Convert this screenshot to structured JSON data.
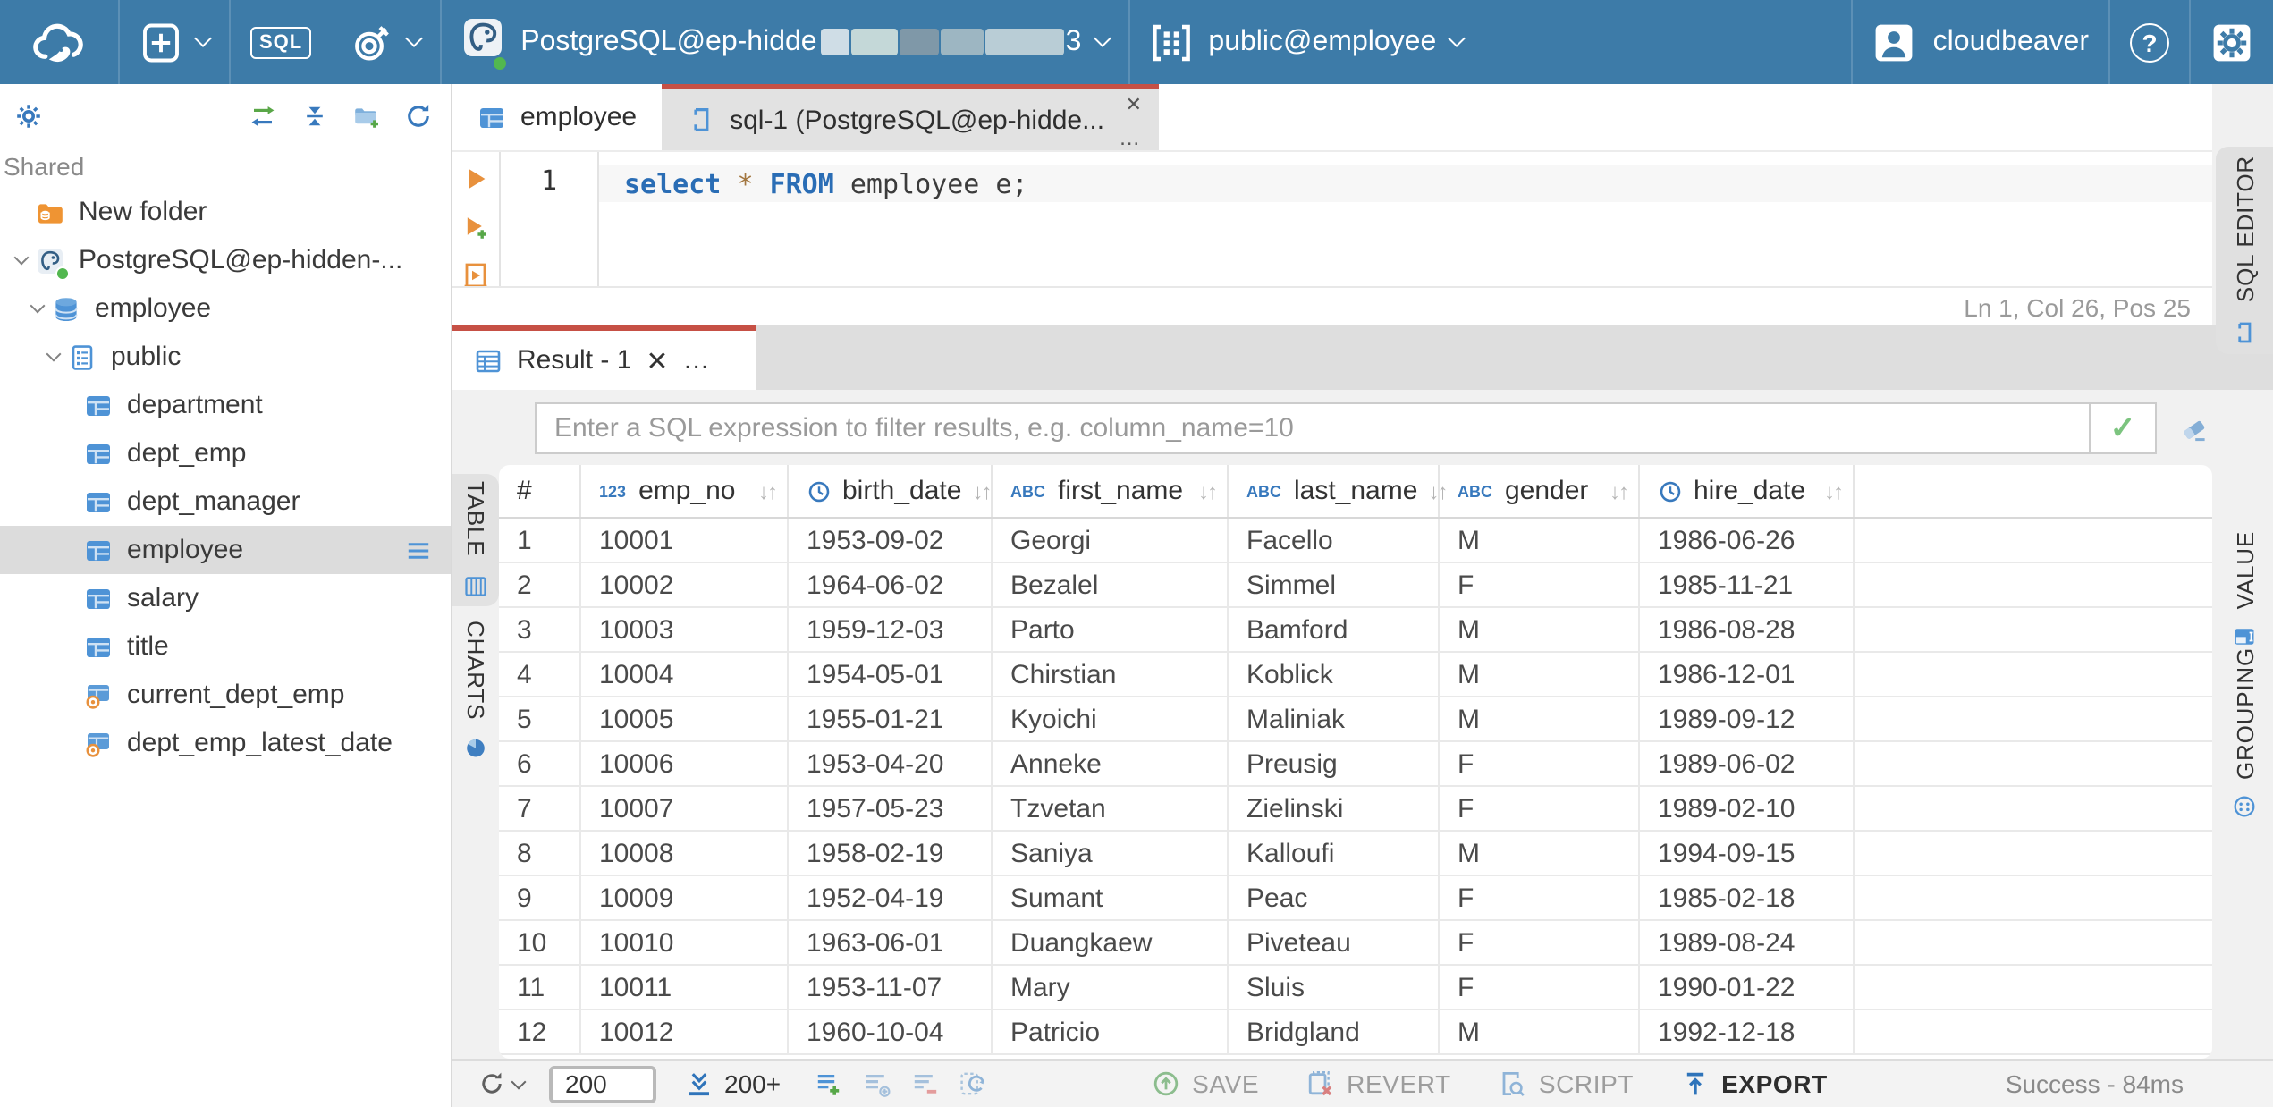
{
  "colors": {
    "topbar_blue": "#3d7ba8",
    "accent_red": "#c65045",
    "icon_blue": "#3879bd",
    "success_green": "#52b74f",
    "orange": "#e8913d"
  },
  "glyphs": {
    "close": "✕",
    "more": "…",
    "check": "✓",
    "sort": "↓↑",
    "help": "?"
  },
  "topbar": {
    "sql_button": "SQL",
    "connection": {
      "name": "PostgreSQL@ep-hidde",
      "suffix": "3"
    },
    "schema": "public@employee",
    "user": "cloudbeaver"
  },
  "sidebar": {
    "section": "Shared",
    "tree": [
      {
        "label": "New folder",
        "icon": "folderdb",
        "depth": 0,
        "expandable": false
      },
      {
        "label": "PostgreSQL@ep-hidden-...",
        "icon": "postgres",
        "depth": 0,
        "expandable": true,
        "status": true
      },
      {
        "label": "employee",
        "icon": "database",
        "depth": 1,
        "expandable": true
      },
      {
        "label": "public",
        "icon": "schema",
        "depth": 2,
        "expandable": true
      },
      {
        "label": "department",
        "icon": "table",
        "depth": 3,
        "expandable": false
      },
      {
        "label": "dept_emp",
        "icon": "table",
        "depth": 3,
        "expandable": false
      },
      {
        "label": "dept_manager",
        "icon": "table",
        "depth": 3,
        "expandable": false
      },
      {
        "label": "employee",
        "icon": "table",
        "depth": 3,
        "expandable": false,
        "selected": true,
        "menu": true
      },
      {
        "label": "salary",
        "icon": "table",
        "depth": 3,
        "expandable": false
      },
      {
        "label": "title",
        "icon": "table",
        "depth": 3,
        "expandable": false
      },
      {
        "label": "current_dept_emp",
        "icon": "view",
        "depth": 3,
        "expandable": false
      },
      {
        "label": "dept_emp_latest_date",
        "icon": "view",
        "depth": 3,
        "expandable": false
      }
    ]
  },
  "editor": {
    "tabs": [
      {
        "label": "employee"
      },
      {
        "label": "sql-1 (PostgreSQL@ep-hidde..."
      }
    ],
    "line_number": "1",
    "code_tokens": [
      {
        "type": "kw",
        "text": "select"
      },
      {
        "type": "plain",
        "text": " "
      },
      {
        "type": "star",
        "text": "*"
      },
      {
        "type": "plain",
        "text": " "
      },
      {
        "type": "kw",
        "text": "FROM"
      },
      {
        "type": "plain",
        "text": " employee e;"
      }
    ],
    "status": "Ln 1, Col 26, Pos 25",
    "side_tab": "SQL EDITOR"
  },
  "result": {
    "tab": "Result - 1",
    "filter_placeholder": "Enter a SQL expression to filter results, e.g. column_name=10",
    "left_tabs": [
      "TABLE",
      "CHARTS"
    ],
    "right_tabs": [
      "VALUE",
      "GROUPING"
    ],
    "table": {
      "columns": [
        {
          "label": "#",
          "type": null,
          "sortable": false
        },
        {
          "label": "emp_no",
          "type": "123",
          "sortable": true
        },
        {
          "label": "birth_date",
          "type": "clock",
          "sortable": true
        },
        {
          "label": "first_name",
          "type": "abc",
          "sortable": true
        },
        {
          "label": "last_name",
          "type": "abc",
          "sortable": true
        },
        {
          "label": "gender",
          "type": "abc",
          "sortable": true
        },
        {
          "label": "hire_date",
          "type": "clock",
          "sortable": true
        }
      ],
      "rows": [
        [
          "1",
          "10001",
          "1953-09-02",
          "Georgi",
          "Facello",
          "M",
          "1986-06-26"
        ],
        [
          "2",
          "10002",
          "1964-06-02",
          "Bezalel",
          "Simmel",
          "F",
          "1985-11-21"
        ],
        [
          "3",
          "10003",
          "1959-12-03",
          "Parto",
          "Bamford",
          "M",
          "1986-08-28"
        ],
        [
          "4",
          "10004",
          "1954-05-01",
          "Chirstian",
          "Koblick",
          "M",
          "1986-12-01"
        ],
        [
          "5",
          "10005",
          "1955-01-21",
          "Kyoichi",
          "Maliniak",
          "M",
          "1989-09-12"
        ],
        [
          "6",
          "10006",
          "1953-04-20",
          "Anneke",
          "Preusig",
          "F",
          "1989-06-02"
        ],
        [
          "7",
          "10007",
          "1957-05-23",
          "Tzvetan",
          "Zielinski",
          "F",
          "1989-02-10"
        ],
        [
          "8",
          "10008",
          "1958-02-19",
          "Saniya",
          "Kalloufi",
          "M",
          "1994-09-15"
        ],
        [
          "9",
          "10009",
          "1952-04-19",
          "Sumant",
          "Peac",
          "F",
          "1985-02-18"
        ],
        [
          "10",
          "10010",
          "1963-06-01",
          "Duangkaew",
          "Piveteau",
          "F",
          "1989-08-24"
        ],
        [
          "11",
          "10011",
          "1953-11-07",
          "Mary",
          "Sluis",
          "F",
          "1990-01-22"
        ],
        [
          "12",
          "10012",
          "1960-10-04",
          "Patricio",
          "Bridgland",
          "M",
          "1992-12-18"
        ]
      ]
    },
    "toolbar": {
      "rows_value": "200",
      "fetch_more": "200+",
      "save": "SAVE",
      "revert": "REVERT",
      "script": "SCRIPT",
      "export": "EXPORT",
      "status": "Success - 84ms"
    }
  }
}
